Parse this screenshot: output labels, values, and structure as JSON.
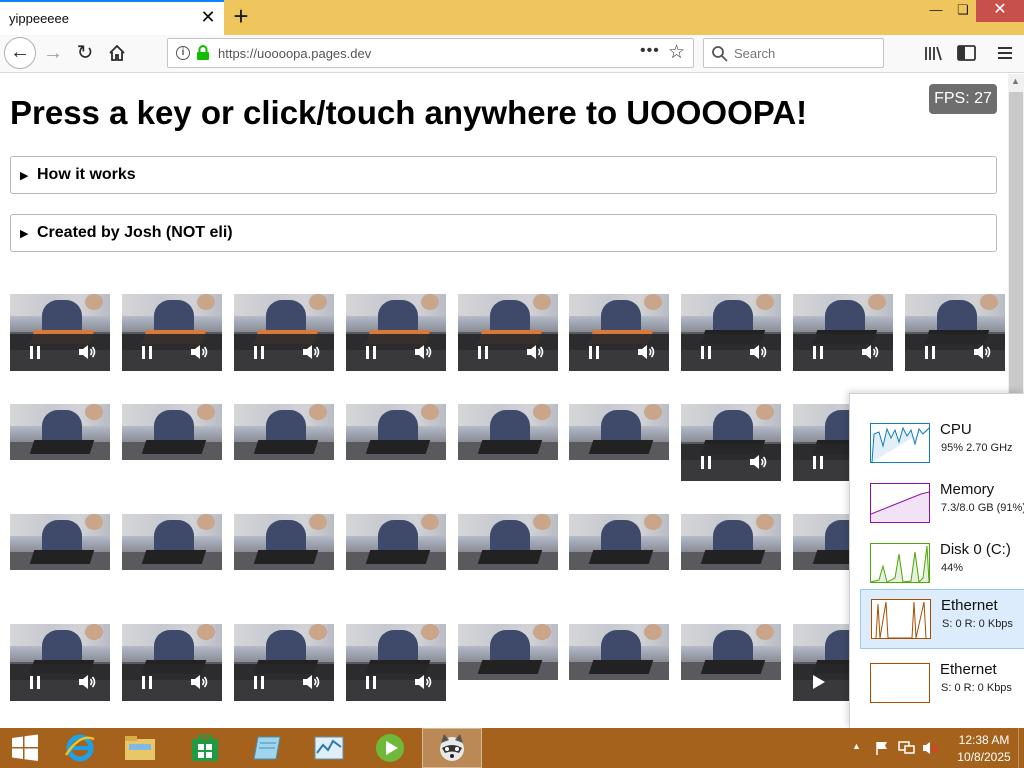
{
  "browser": {
    "tab_title": "yippeeeee",
    "tab_close": "✕",
    "new_tab": "+",
    "url": "https://uoooopa.pages.dev",
    "search_placeholder": "Search",
    "accent_color": "#0a84ff",
    "chrome_color": "#efc55e"
  },
  "page": {
    "headline": "Press a key or click/touch anywhere to UOOOOPA!",
    "fps": "FPS: 27",
    "details": [
      {
        "summary": "How it works"
      },
      {
        "summary": "Created by Josh (NOT eli)"
      }
    ],
    "video_grid": {
      "rows": [
        [
          {
            "controls": "pause",
            "keyboard": "orange"
          },
          {
            "controls": "pause",
            "keyboard": "orange"
          },
          {
            "controls": "pause",
            "keyboard": "orange"
          },
          {
            "controls": "pause",
            "keyboard": "orange"
          },
          {
            "controls": "pause",
            "keyboard": "orange"
          },
          {
            "controls": "pause",
            "keyboard": "orange"
          },
          {
            "controls": "pause",
            "keyboard": "dark"
          },
          {
            "controls": "pause",
            "keyboard": "dark"
          },
          {
            "controls": "pause",
            "keyboard": "dark"
          }
        ],
        [
          {
            "controls": "none",
            "keyboard": "dark"
          },
          {
            "controls": "none",
            "keyboard": "dark"
          },
          {
            "controls": "none",
            "keyboard": "dark"
          },
          {
            "controls": "none",
            "keyboard": "dark"
          },
          {
            "controls": "none",
            "keyboard": "dark"
          },
          {
            "controls": "none",
            "keyboard": "dark"
          },
          {
            "controls": "pause",
            "keyboard": "dark"
          },
          {
            "controls": "pause",
            "keyboard": "dark"
          }
        ],
        [
          {
            "controls": "none",
            "keyboard": "dark"
          },
          {
            "controls": "none",
            "keyboard": "dark"
          },
          {
            "controls": "none",
            "keyboard": "dark"
          },
          {
            "controls": "none",
            "keyboard": "dark"
          },
          {
            "controls": "none",
            "keyboard": "dark"
          },
          {
            "controls": "none",
            "keyboard": "dark"
          },
          {
            "controls": "none",
            "keyboard": "dark"
          },
          {
            "controls": "none",
            "keyboard": "dark"
          }
        ],
        [
          {
            "controls": "pause",
            "keyboard": "dark"
          },
          {
            "controls": "pause",
            "keyboard": "dark"
          },
          {
            "controls": "pause",
            "keyboard": "dark"
          },
          {
            "controls": "pause",
            "keyboard": "dark"
          },
          {
            "controls": "none",
            "keyboard": "dark"
          },
          {
            "controls": "none",
            "keyboard": "dark"
          },
          {
            "controls": "none",
            "keyboard": "dark"
          },
          {
            "controls": "play",
            "keyboard": "dark"
          }
        ]
      ]
    }
  },
  "task_manager": {
    "items": [
      {
        "name": "CPU",
        "value": "95% 2.70 GHz",
        "color": "#117dbb",
        "selected": false
      },
      {
        "name": "Memory",
        "value": "7.3/8.0 GB (91%)",
        "color": "#8b12ae",
        "selected": false
      },
      {
        "name": "Disk 0 (C:)",
        "value": "44%",
        "color": "#4da60c",
        "selected": false
      },
      {
        "name": "Ethernet",
        "value": "S: 0 R: 0 Kbps",
        "color": "#a74f01",
        "selected": true
      },
      {
        "name": "Ethernet",
        "value": "S: 0 R: 0 Kbps",
        "color": "#a74f01",
        "selected": false
      }
    ]
  },
  "taskbar": {
    "apps": [
      "start",
      "internet-explorer",
      "file-explorer",
      "store",
      "notepad-like",
      "task-manager",
      "media-player",
      "firefox"
    ],
    "time": "12:38 AM",
    "date": "10/8/2025",
    "color": "#a5621c"
  }
}
